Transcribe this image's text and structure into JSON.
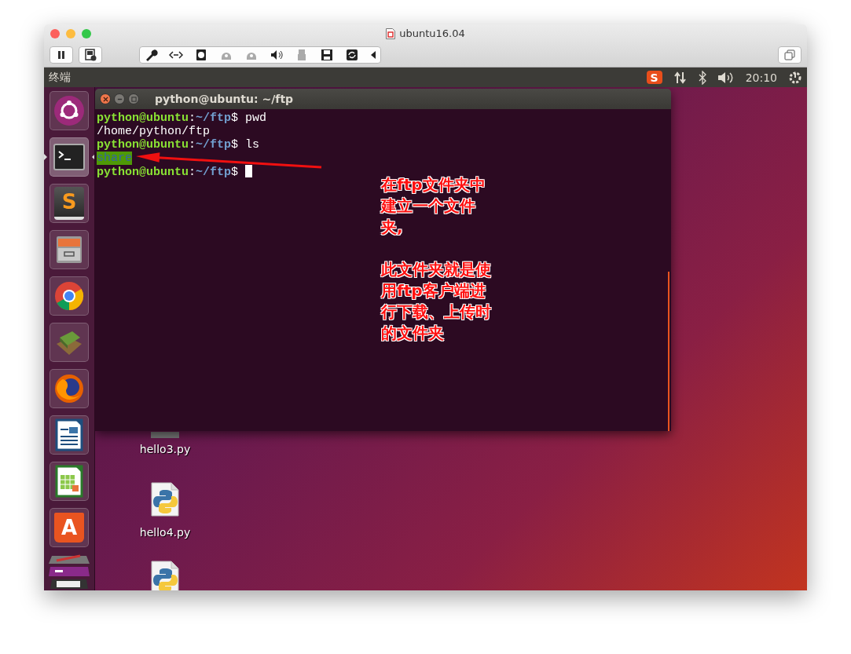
{
  "window": {
    "title": "ubuntu16.04"
  },
  "top_panel": {
    "app_name": "终端",
    "ime_badge": "S",
    "clock": "20:10"
  },
  "launcher": [
    {
      "kind": "dash",
      "active": false
    },
    {
      "kind": "terminal",
      "active": true
    },
    {
      "kind": "editor",
      "glyph": "S",
      "active": false
    },
    {
      "kind": "files",
      "active": false
    },
    {
      "kind": "browser",
      "active": false
    },
    {
      "kind": "books",
      "active": false
    },
    {
      "kind": "firefox",
      "active": false
    },
    {
      "kind": "writer",
      "active": false
    },
    {
      "kind": "calc",
      "active": false
    },
    {
      "kind": "store",
      "glyph": "A",
      "active": false
    }
  ],
  "terminal": {
    "title": "python@ubuntu: ~/ftp",
    "lines": [
      {
        "kind": "prompt",
        "user": "python@ubuntu",
        "sep": ":",
        "path": "~/ftp",
        "tail": "$ pwd"
      },
      {
        "kind": "output",
        "text": "/home/python/ftp"
      },
      {
        "kind": "prompt",
        "user": "python@ubuntu",
        "sep": ":",
        "path": "~/ftp",
        "tail": "$ ls"
      },
      {
        "kind": "dir",
        "text": "share"
      },
      {
        "kind": "prompt",
        "user": "python@ubuntu",
        "sep": ":",
        "path": "~/ftp",
        "tail": "$ ",
        "cursor": true
      }
    ]
  },
  "annotation": {
    "paragraphs": [
      "在ftp文件夹中建立一个文件夹,",
      "此文件夹就是使用ftp客户端进行下载、上传时的文件夹"
    ]
  },
  "desktop_icons": [
    {
      "label": "hello3.py"
    },
    {
      "label": "hello4.py"
    },
    {
      "kind": "picture"
    }
  ]
}
